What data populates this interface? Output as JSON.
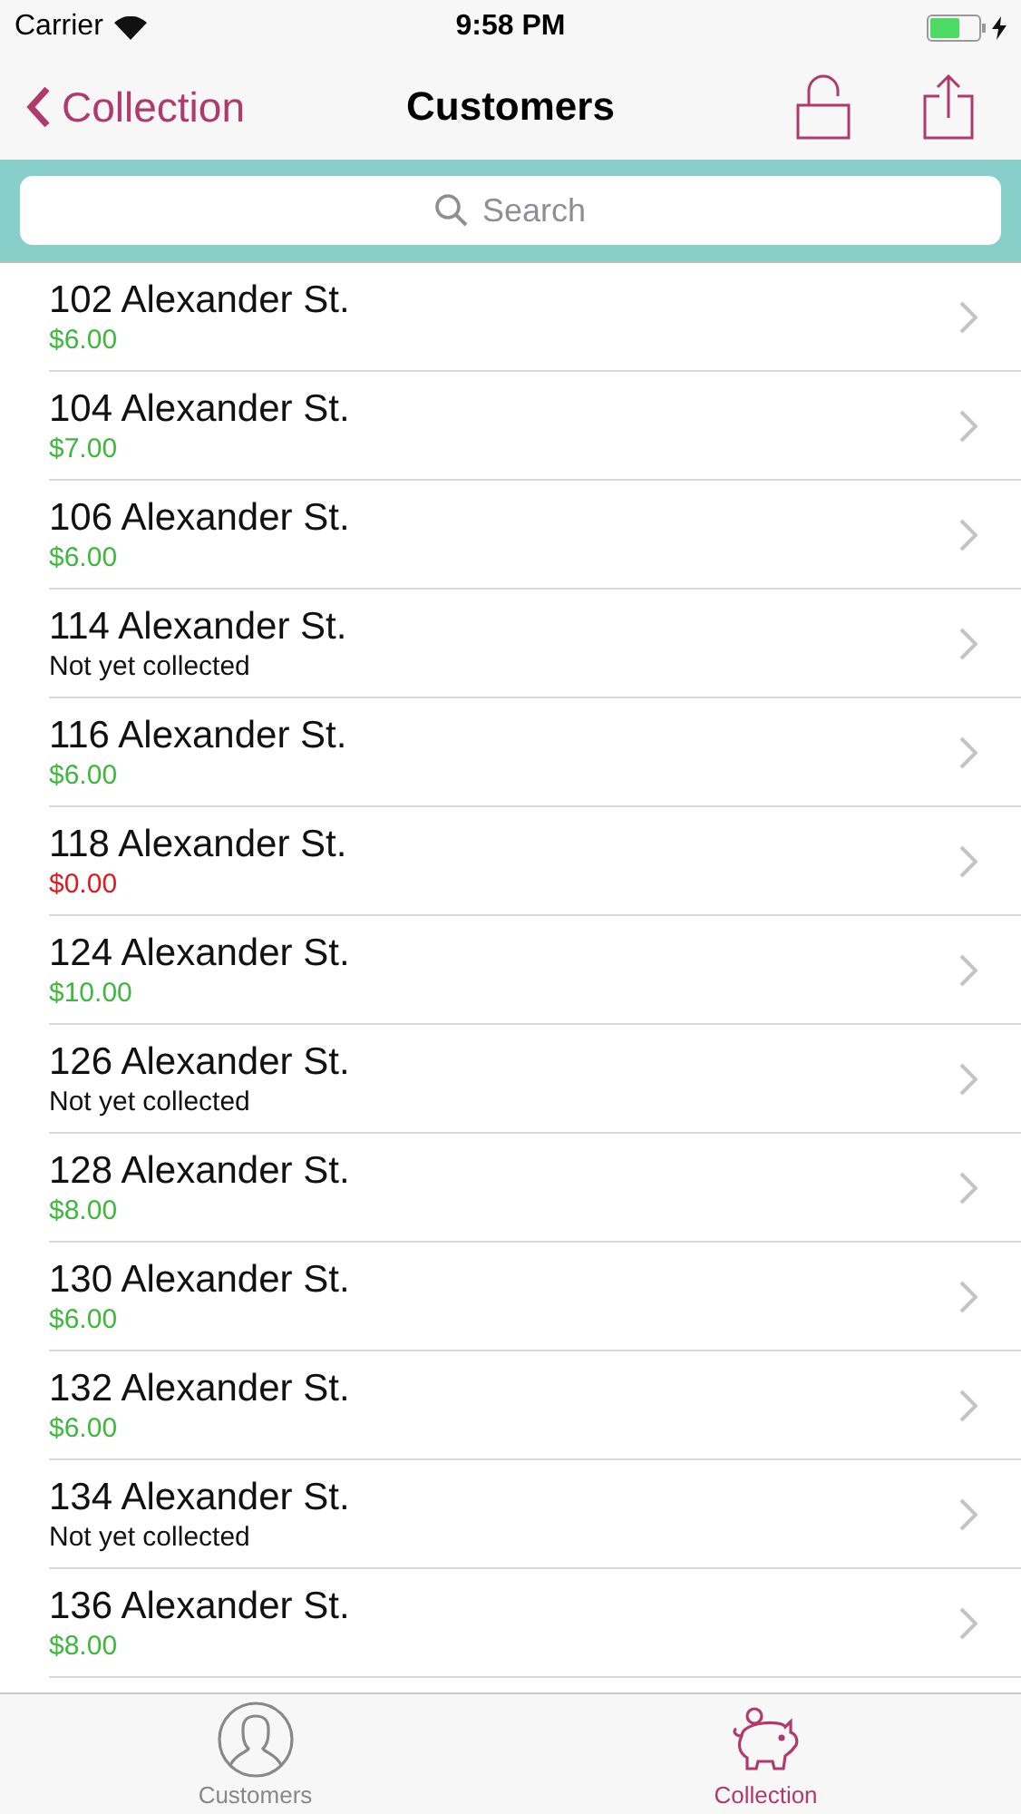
{
  "status_bar": {
    "carrier": "Carrier",
    "time": "9:58 PM"
  },
  "nav": {
    "back": "Collection",
    "title": "Customers"
  },
  "search": {
    "placeholder": "Search"
  },
  "rows": [
    {
      "address": "102 Alexander St.",
      "detail": "$6.00",
      "kind": "paid"
    },
    {
      "address": "104 Alexander St.",
      "detail": "$7.00",
      "kind": "paid"
    },
    {
      "address": "106 Alexander St.",
      "detail": "$6.00",
      "kind": "paid"
    },
    {
      "address": "114 Alexander St.",
      "detail": "Not yet collected",
      "kind": "pending"
    },
    {
      "address": "116 Alexander St.",
      "detail": "$6.00",
      "kind": "paid"
    },
    {
      "address": "118 Alexander St.",
      "detail": "$0.00",
      "kind": "zero"
    },
    {
      "address": "124 Alexander St.",
      "detail": "$10.00",
      "kind": "paid"
    },
    {
      "address": "126 Alexander St.",
      "detail": "Not yet collected",
      "kind": "pending"
    },
    {
      "address": "128 Alexander St.",
      "detail": "$8.00",
      "kind": "paid"
    },
    {
      "address": "130 Alexander St.",
      "detail": "$6.00",
      "kind": "paid"
    },
    {
      "address": "132 Alexander St.",
      "detail": "$6.00",
      "kind": "paid"
    },
    {
      "address": "134 Alexander St.",
      "detail": "Not yet collected",
      "kind": "pending"
    },
    {
      "address": "136 Alexander St.",
      "detail": "$8.00",
      "kind": "paid"
    }
  ],
  "tabs": [
    {
      "label": "Customers",
      "kind": "person",
      "selected": false
    },
    {
      "label": "Collection",
      "kind": "piggy",
      "selected": true
    }
  ]
}
